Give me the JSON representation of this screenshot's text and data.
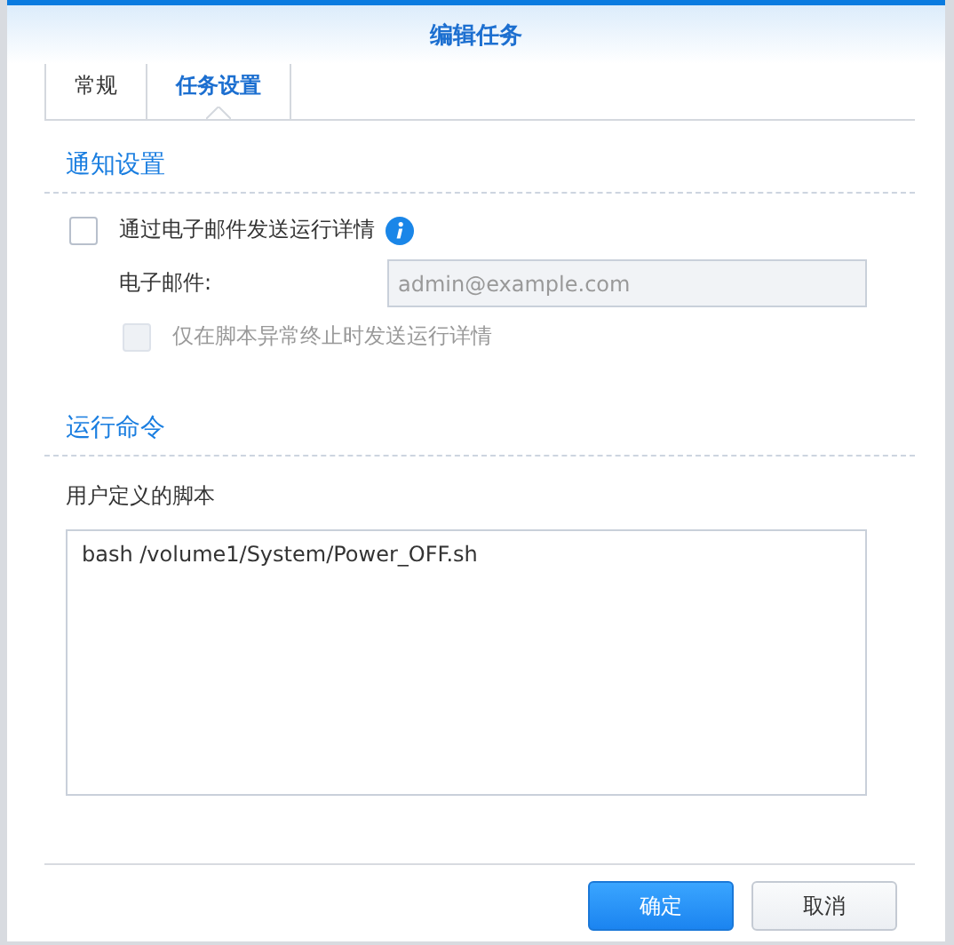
{
  "window": {
    "title": "编辑任务"
  },
  "tabs": [
    {
      "label": "常规",
      "selected": false
    },
    {
      "label": "任务设置",
      "selected": true
    }
  ],
  "notification": {
    "heading": "通知设置",
    "send_email": {
      "label": "通过电子邮件发送运行详情",
      "checked": false
    },
    "email": {
      "label": "电子邮件:",
      "placeholder": "admin@example.com",
      "disabled": true
    },
    "only_on_error": {
      "label": "仅在脚本异常终止时发送运行详情",
      "checked": false,
      "disabled": true
    }
  },
  "run_command": {
    "heading": "运行命令",
    "script_label": "用户定义的脚本",
    "script": "bash /volume1/System/Power_OFF.sh"
  },
  "buttons": [
    {
      "label": "确定",
      "kind": "primary"
    },
    {
      "label": "取消",
      "kind": "secondary"
    }
  ]
}
